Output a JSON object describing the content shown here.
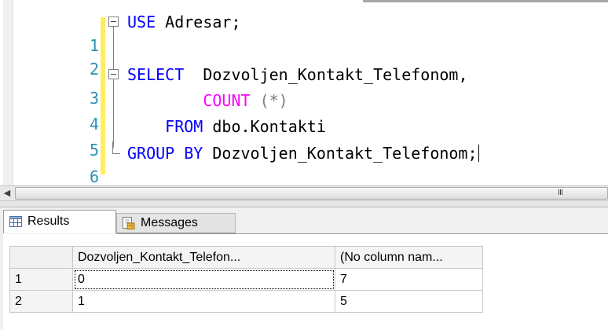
{
  "editor": {
    "lines": [
      {
        "num": "1",
        "tokens": [
          {
            "t": "USE",
            "c": "kw"
          },
          {
            "t": " Adresar;",
            "c": "tx"
          }
        ]
      },
      {
        "num": "2",
        "tokens": []
      },
      {
        "num": "3",
        "tokens": [
          {
            "t": "SELECT",
            "c": "kw"
          },
          {
            "t": "  Dozvoljen_Kontakt_Telefonom,",
            "c": "tx"
          }
        ]
      },
      {
        "num": "4",
        "tokens": [
          {
            "t": "        ",
            "c": "tx"
          },
          {
            "t": "COUNT",
            "c": "fn"
          },
          {
            "t": " (*)",
            "c": "gr"
          }
        ]
      },
      {
        "num": "5",
        "tokens": [
          {
            "t": "    ",
            "c": "tx"
          },
          {
            "t": "FROM",
            "c": "kw"
          },
          {
            "t": " dbo.Kontakti",
            "c": "tx"
          }
        ]
      },
      {
        "num": "6",
        "tokens": [
          {
            "t": "GROUP BY",
            "c": "kw"
          },
          {
            "t": " Dozvoljen_Kontakt_Telefonom;",
            "c": "tx"
          }
        ]
      }
    ]
  },
  "scrollbar": {
    "grip": "III"
  },
  "tabs": {
    "results_label": "Results",
    "messages_label": "Messages",
    "active": "Results"
  },
  "results": {
    "columns": [
      "Dozvoljen_Kontakt_Telefon...",
      "(No column nam..."
    ],
    "rows": [
      {
        "num": "1",
        "cells": [
          "0",
          "7"
        ]
      },
      {
        "num": "2",
        "cells": [
          "1",
          "5"
        ]
      }
    ]
  }
}
